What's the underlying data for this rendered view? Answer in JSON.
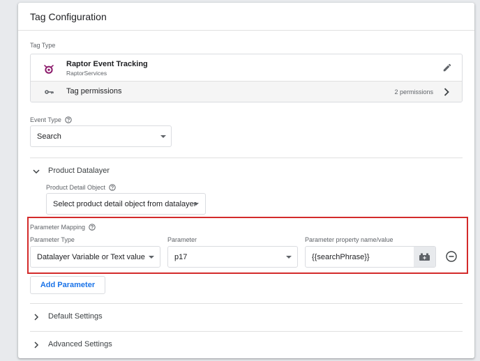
{
  "card": {
    "title": "Tag Configuration"
  },
  "tag_type": {
    "label": "Tag Type",
    "name": "Raptor Event Tracking",
    "vendor": "RaptorServices",
    "permissions_label": "Tag permissions",
    "permissions_count": "2 permissions"
  },
  "event_type": {
    "label": "Event Type",
    "value": "Search"
  },
  "product_datalayer": {
    "section_label": "Product Datalayer",
    "detail_object_label": "Product Detail Object",
    "detail_object_value": "Select product detail object from datalayer"
  },
  "parameter_mapping": {
    "label": "Parameter Mapping",
    "type_label": "Parameter Type",
    "type_value": "Datalayer Variable or Text value",
    "param_label": "Parameter",
    "param_value": "p17",
    "property_label": "Parameter property name/value",
    "property_value": "{{searchPhrase}}",
    "add_button": "Add Parameter"
  },
  "sections": {
    "default_settings": "Default Settings",
    "advanced_settings": "Advanced Settings"
  },
  "colors": {
    "highlight": "#d32a2a",
    "link_blue": "#1a73e8",
    "raptor_purple": "#8b1a6b"
  }
}
